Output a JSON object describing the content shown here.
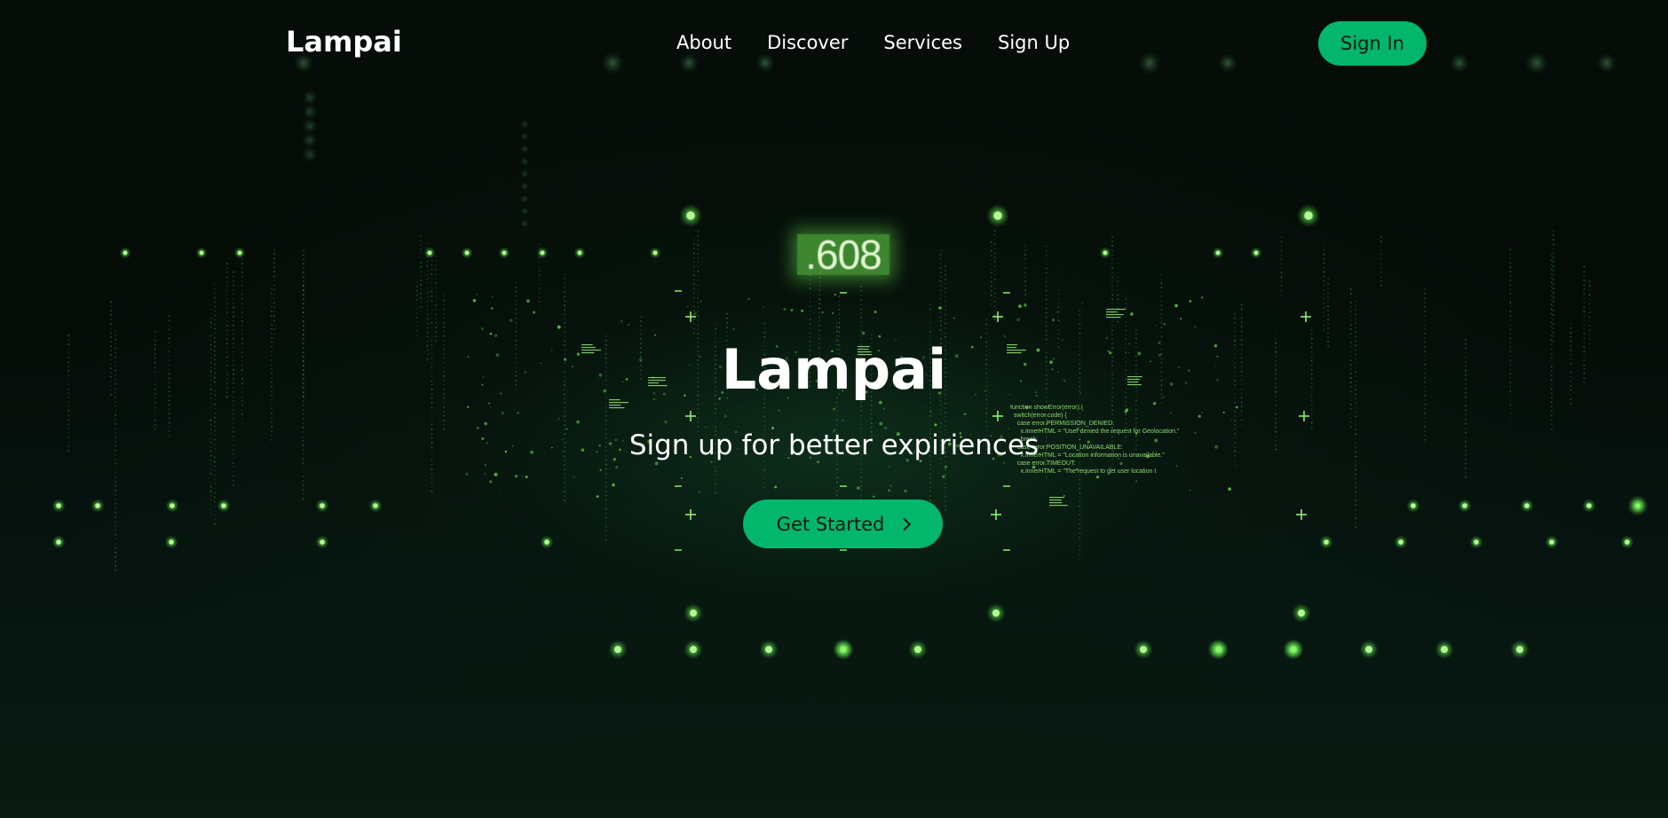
{
  "brand": {
    "name": "Lampai"
  },
  "nav": {
    "links": [
      {
        "label": "About"
      },
      {
        "label": "Discover"
      },
      {
        "label": "Services"
      },
      {
        "label": "Sign Up"
      }
    ],
    "sign_in_label": "Sign In"
  },
  "hero": {
    "counter": ".608",
    "title": "Lampai",
    "subtitle": "Sign up for better expiriences",
    "cta_label": "Get Started",
    "cta_icon": "chevron-right-icon"
  },
  "background": {
    "code_lines": [
      "function showError(error) {",
      "  switch(error.code) {",
      "    case error.PERMISSION_DENIED:",
      "      x.innerHTML = \"User denied the request for Geolocation.\"",
      "      break;",
      "    case error.POSITION_UNAVAILABLE:",
      "      x.innerHTML = \"Location information is unavailable.\"",
      "    case error.TIMEOUT:",
      "      x.innerHTML = \"The request to get user location t"
    ]
  },
  "colors": {
    "accent": "#02b66b",
    "background": "#040a07",
    "glow": "#7cf05a",
    "text": "#ffffff"
  }
}
